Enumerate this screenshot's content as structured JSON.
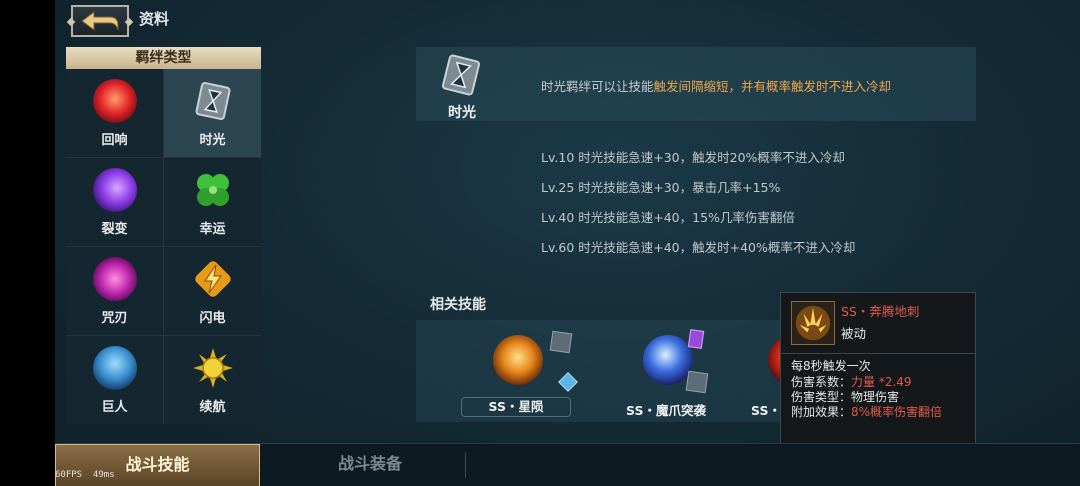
{
  "header": {
    "title": "资料",
    "back_icon": "back-arrow-icon"
  },
  "bond_panel": {
    "title": "羁绊类型",
    "items": [
      {
        "label": "回响",
        "icon": "echo-icon",
        "selected": false
      },
      {
        "label": "时光",
        "icon": "hourglass-icon",
        "selected": true
      },
      {
        "label": "裂变",
        "icon": "fission-icon",
        "selected": false
      },
      {
        "label": "幸运",
        "icon": "clover-icon",
        "selected": false
      },
      {
        "label": "咒刃",
        "icon": "cursed-blade-icon",
        "selected": false
      },
      {
        "label": "闪电",
        "icon": "lightning-icon",
        "selected": false
      },
      {
        "label": "巨人",
        "icon": "giant-icon",
        "selected": false
      },
      {
        "label": "续航",
        "icon": "sun-icon",
        "selected": false
      }
    ]
  },
  "description": {
    "name": "时光",
    "text_prefix": "时光羁绊可以让技能",
    "text_highlight": "触发间隔缩短，并有概率触发时不进入冷却"
  },
  "levels": [
    "Lv.10  时光技能急速+30，触发时20%概率不进入冷却",
    "Lv.25  时光技能急速+30，暴击几率+15%",
    "Lv.40  时光技能急速+40，15%几率伤害翻倍",
    "Lv.60  时光技能急速+40，触发时+40%概率不进入冷却"
  ],
  "related": {
    "title": "相关技能",
    "skills": [
      {
        "name": "SS・星陨",
        "icon": "meteor-skill-icon"
      },
      {
        "name": "SS・魔爪突袭",
        "icon": "demon-claw-skill-icon"
      },
      {
        "name": "SS・恶魔钩锁",
        "icon": "demon-hook-skill-icon"
      }
    ]
  },
  "tooltip": {
    "title": "SS・奔腾地刺",
    "type": "被动",
    "trigger": "每8秒触发一次",
    "coef_label": "伤害系数：",
    "coef_value": "力量 *2.49",
    "dmg_type_label": "伤害类型：",
    "dmg_type_value": "物理伤害",
    "extra_label": "附加效果：",
    "extra_value": "8%概率伤害翻倍"
  },
  "bottom_tabs": {
    "active": "战斗技能",
    "inactive": "战斗装备"
  },
  "debug": {
    "fps": "60FPS",
    "ms": "49ms"
  }
}
